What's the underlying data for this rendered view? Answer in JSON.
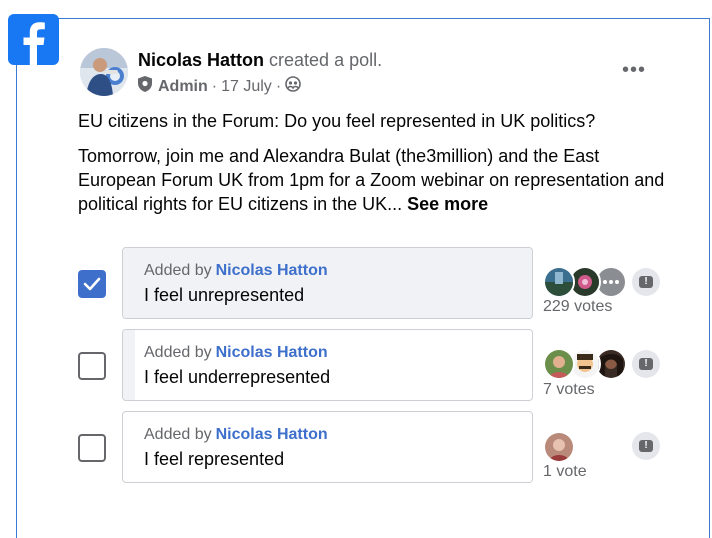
{
  "post": {
    "author": "Nicolas Hatton",
    "action": "created a poll.",
    "role": "Admin",
    "date": "17 July",
    "dot": "·",
    "question": "EU citizens in the Forum: Do you feel represented in UK politics?",
    "body": "Tomorrow, join me and Alexandra Bulat (the3million) and the East European Forum UK from 1pm for a Zoom webinar on representation and political rights for EU citizens in the UK...",
    "see_more": "See more"
  },
  "more_label": "•••",
  "poll": {
    "options": [
      {
        "added_by_prefix": "Added by",
        "added_by": "Nicolas Hatton",
        "label": "I feel unrepresented",
        "votes": "229 votes",
        "checked": true,
        "fill_fraction": 1.0
      },
      {
        "added_by_prefix": "Added by",
        "added_by": "Nicolas Hatton",
        "label": "I feel underrepresented",
        "votes": "7 votes",
        "checked": false,
        "fill_fraction": 0.03
      },
      {
        "added_by_prefix": "Added by",
        "added_by": "Nicolas Hatton",
        "label": "I feel represented",
        "votes": "1 vote",
        "checked": false,
        "fill_fraction": 0.0
      }
    ]
  },
  "report_symbol": "!",
  "colors": {
    "facebook_blue": "#1877f2",
    "link_blue": "#3d6fcb",
    "muted_text": "#65676b",
    "poll_fill": "#f0f2f5"
  }
}
